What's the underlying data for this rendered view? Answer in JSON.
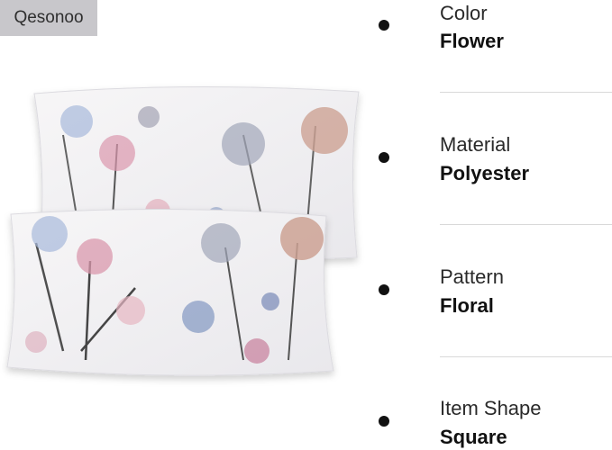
{
  "brand": {
    "name": "Qesonoo"
  },
  "product_image": {
    "description_icon": "floral-pillowcase-image"
  },
  "specs": [
    {
      "label": "Color",
      "value": "Flower"
    },
    {
      "label": "Material",
      "value": "Polyester"
    },
    {
      "label": "Pattern",
      "value": "Floral"
    },
    {
      "label": "Item Shape",
      "value": "Square"
    }
  ]
}
